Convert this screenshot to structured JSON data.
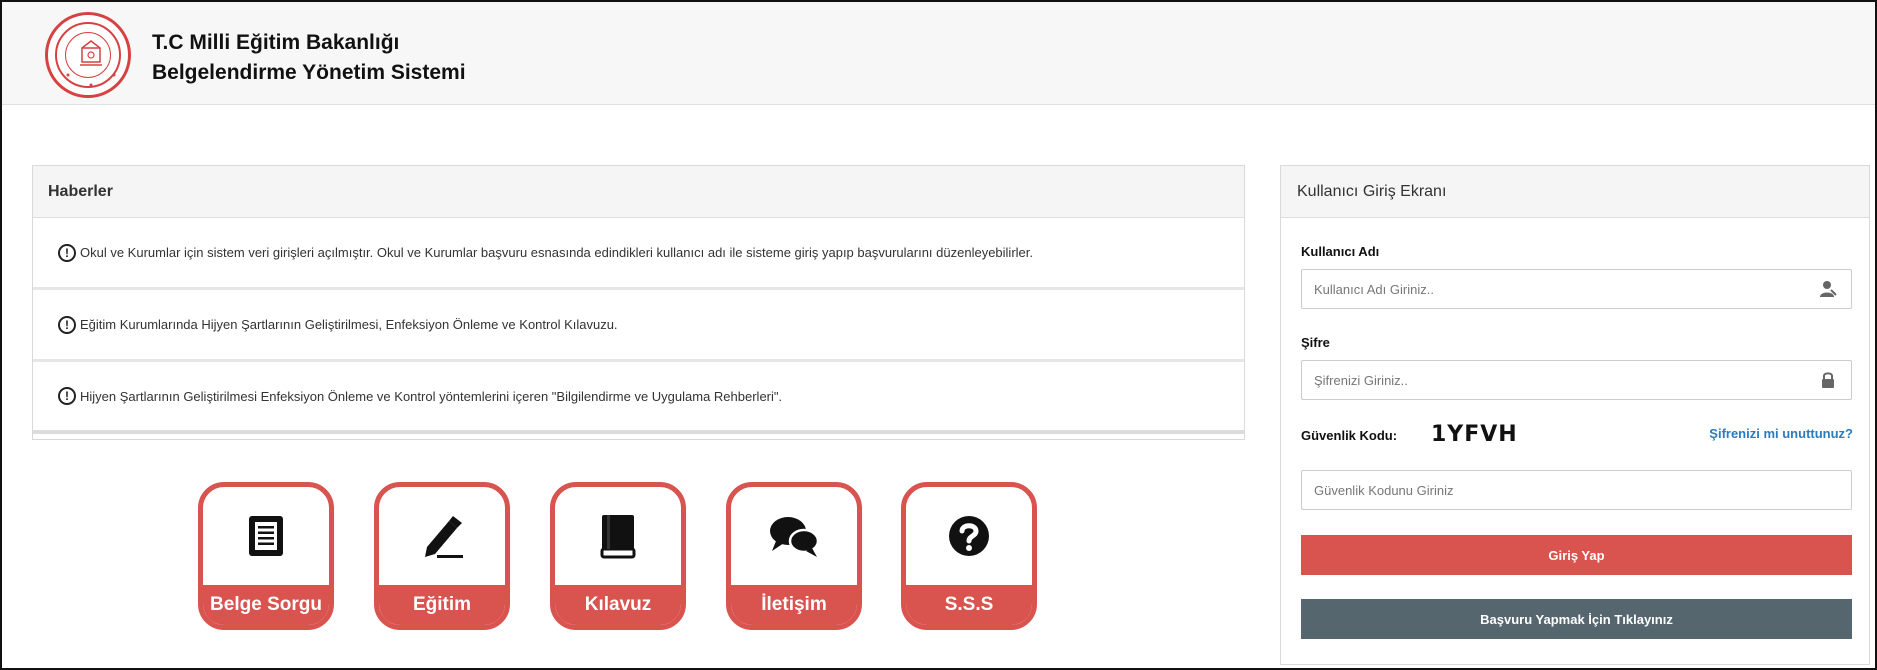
{
  "header": {
    "title_line1": "T.C Milli Eğitim Bakanlığı",
    "title_line2": "Belgelendirme Yönetim Sistemi"
  },
  "news": {
    "title": "Haberler",
    "items": [
      {
        "text": "Okul ve Kurumlar için sistem veri girişleri açılmıştır. Okul ve Kurumlar başvuru esnasında edindikleri kullanıcı adı ile sisteme giriş yapıp başvurularını düzenleyebilirler."
      },
      {
        "text": "Eğitim Kurumlarında Hijyen Şartlarının Geliştirilmesi, Enfeksiyon Önleme ve Kontrol Kılavuzu."
      },
      {
        "text": "Hijyen Şartlarının Geliştirilmesi Enfeksiyon Önleme ve Kontrol yöntemlerini içeren \"Bilgilendirme ve Uygulama Rehberleri\"."
      }
    ]
  },
  "tiles": [
    {
      "label": "Belge Sorgu",
      "icon": "document-list-icon"
    },
    {
      "label": "Eğitim",
      "icon": "pencil-icon"
    },
    {
      "label": "Kılavuz",
      "icon": "book-icon"
    },
    {
      "label": "İletişim",
      "icon": "chat-bubbles-icon"
    },
    {
      "label": "S.S.S",
      "icon": "question-circle-icon"
    }
  ],
  "login": {
    "title": "Kullanıcı Giriş Ekranı",
    "username_label": "Kullanıcı Adı",
    "username_placeholder": "Kullanıcı Adı Giriniz..",
    "password_label": "Şifre",
    "password_placeholder": "Şifrenizi Giriniz..",
    "captcha_label": "Güvenlik Kodu:",
    "captcha_code": "1YFVH",
    "forgot_link": "Şifrenizi mi unuttunuz?",
    "captcha_placeholder": "Güvenlik Kodunu Giriniz",
    "login_button": "Giriş Yap",
    "apply_button": "Başvuru Yapmak İçin Tıklayınız"
  },
  "colors": {
    "accent_red": "#d9534f",
    "button_gray": "#56666f",
    "link_blue": "#2b7bbd"
  }
}
